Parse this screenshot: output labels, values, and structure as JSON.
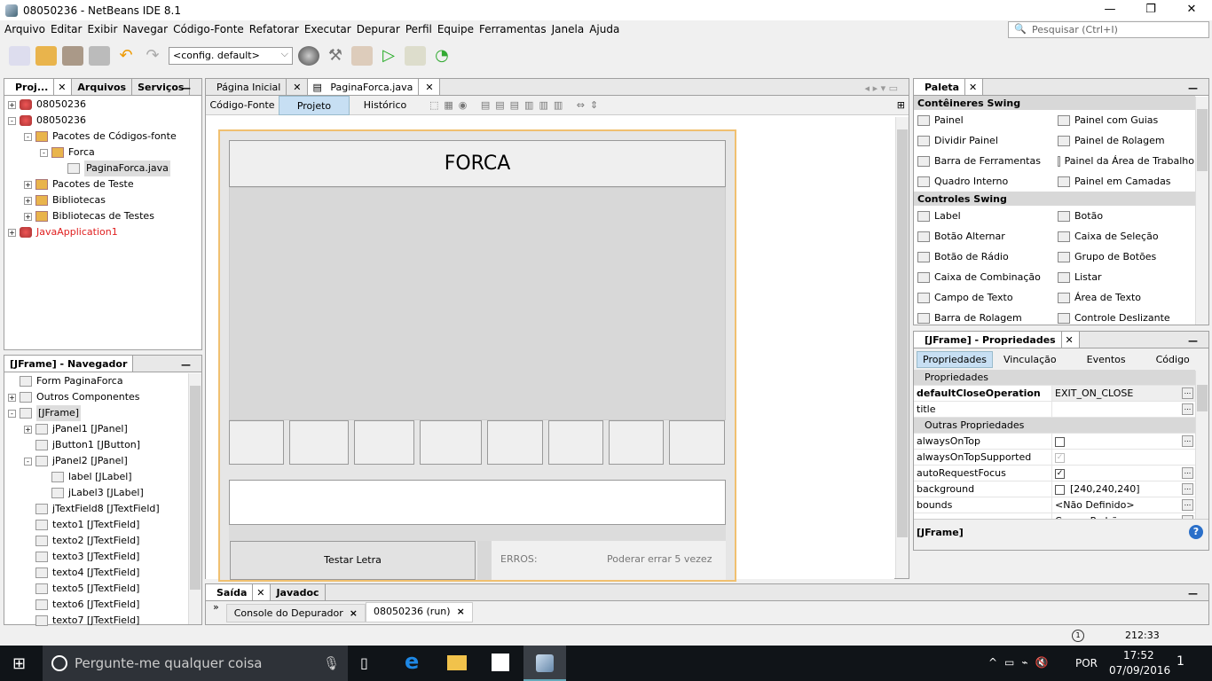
{
  "window": {
    "title": "08050236 - NetBeans IDE 8.1",
    "minimize": "—",
    "maximize": "❐",
    "close": "✕"
  },
  "menu": [
    "Arquivo",
    "Editar",
    "Exibir",
    "Navegar",
    "Código-Fonte",
    "Refatorar",
    "Executar",
    "Depurar",
    "Perfil",
    "Equipe",
    "Ferramentas",
    "Janela",
    "Ajuda"
  ],
  "search": {
    "placeholder": "Pesquisar (Ctrl+I)"
  },
  "toolbar": {
    "config": "<config. default>"
  },
  "projects": {
    "tabs": [
      "Proj...",
      "Arquivos",
      "Serviços"
    ],
    "tree": [
      {
        "label": "08050236",
        "level": 0,
        "exp": "+",
        "icon": "cup"
      },
      {
        "label": "08050236",
        "level": 0,
        "exp": "-",
        "icon": "cup"
      },
      {
        "label": "Pacotes de Códigos-fonte",
        "level": 1,
        "exp": "-",
        "icon": "pkg"
      },
      {
        "label": "Forca",
        "level": 2,
        "exp": "-",
        "icon": "pkg"
      },
      {
        "label": "PaginaForca.java",
        "level": 3,
        "exp": "",
        "icon": "comp",
        "selected": true
      },
      {
        "label": "Pacotes de Teste",
        "level": 1,
        "exp": "+",
        "icon": "pkg"
      },
      {
        "label": "Bibliotecas",
        "level": 1,
        "exp": "+",
        "icon": "pkg"
      },
      {
        "label": "Bibliotecas de Testes",
        "level": 1,
        "exp": "+",
        "icon": "pkg"
      },
      {
        "label": "JavaApplication1",
        "level": 0,
        "exp": "+",
        "icon": "cup",
        "red": true
      }
    ]
  },
  "navigator": {
    "title": "[JFrame] - Navegador",
    "tree": [
      {
        "label": "Form PaginaForca",
        "level": 0,
        "exp": ""
      },
      {
        "label": "Outros Componentes",
        "level": 0,
        "exp": "+"
      },
      {
        "label": "[JFrame]",
        "level": 0,
        "exp": "-",
        "selected": true
      },
      {
        "label": "jPanel1 [JPanel]",
        "level": 1,
        "exp": "+"
      },
      {
        "label": "jButton1 [JButton]",
        "level": 1,
        "exp": ""
      },
      {
        "label": "jPanel2 [JPanel]",
        "level": 1,
        "exp": "-"
      },
      {
        "label": "label [JLabel]",
        "level": 2,
        "exp": ""
      },
      {
        "label": "jLabel3 [JLabel]",
        "level": 2,
        "exp": ""
      },
      {
        "label": "jTextField8 [JTextField]",
        "level": 1,
        "exp": ""
      },
      {
        "label": "texto1 [JTextField]",
        "level": 1,
        "exp": ""
      },
      {
        "label": "texto2 [JTextField]",
        "level": 1,
        "exp": ""
      },
      {
        "label": "texto3 [JTextField]",
        "level": 1,
        "exp": ""
      },
      {
        "label": "texto4 [JTextField]",
        "level": 1,
        "exp": ""
      },
      {
        "label": "texto5 [JTextField]",
        "level": 1,
        "exp": ""
      },
      {
        "label": "texto6 [JTextField]",
        "level": 1,
        "exp": ""
      },
      {
        "label": "texto7 [JTextField]",
        "level": 1,
        "exp": ""
      }
    ]
  },
  "editor": {
    "tabs": [
      "Página Inicial",
      "PaginaForca.java"
    ],
    "views": [
      "Código-Fonte",
      "Projeto",
      "Histórico"
    ],
    "active_view": "Projeto"
  },
  "form": {
    "title": "FORCA",
    "button": "Testar Letra",
    "errors_label": "ERROS:",
    "errors_text": "Poderar errar 5 vezez"
  },
  "output": {
    "tabs": [
      "Saída",
      "Javadoc"
    ],
    "subtabs": [
      "Console do Depurador",
      "08050236 (run)"
    ]
  },
  "palette": {
    "title": "Paleta",
    "sections": [
      {
        "name": "Contêineres Swing",
        "items": [
          "Painel",
          "Painel com Guias",
          "Dividir Painel",
          "Painel de Rolagem",
          "Barra de Ferramentas",
          "Painel da Área de Trabalho",
          "Quadro Interno",
          "Painel em Camadas"
        ]
      },
      {
        "name": "Controles Swing",
        "items": [
          "Label",
          "Botão",
          "Botão Alternar",
          "Caixa de Seleção",
          "Botão de Rádio",
          "Grupo de Botões",
          "Caixa de Combinação",
          "Listar",
          "Campo de Texto",
          "Área de Texto",
          "Barra de Rolagem",
          "Controle Deslizante"
        ]
      }
    ]
  },
  "properties": {
    "title": "[JFrame] - Propriedades",
    "tabs": [
      "Propriedades",
      "Vinculação",
      "Eventos",
      "Código"
    ],
    "groups": [
      {
        "name": "Propriedades",
        "rows": [
          {
            "name": "defaultCloseOperation",
            "value": "EXIT_ON_CLOSE",
            "bold": true
          },
          {
            "name": "title",
            "value": ""
          }
        ]
      },
      {
        "name": "Outras Propriedades",
        "rows": [
          {
            "name": "alwaysOnTop",
            "check": false
          },
          {
            "name": "alwaysOnTopSupported",
            "check": true,
            "disabled": true
          },
          {
            "name": "autoRequestFocus",
            "check": true
          },
          {
            "name": "background",
            "value": "[240,240,240]",
            "swatch": true
          },
          {
            "name": "bounds",
            "value": "<Não Definido>"
          },
          {
            "name": "cursor",
            "value": "Cursor Padrão"
          }
        ]
      }
    ],
    "footer": "[JFrame]"
  },
  "status": {
    "position": "212:33",
    "notifications": "1"
  },
  "taskbar": {
    "search_placeholder": "Pergunte-me qualquer coisa",
    "lang": "POR",
    "time": "17:52",
    "date": "07/09/2016",
    "notif": "1"
  }
}
